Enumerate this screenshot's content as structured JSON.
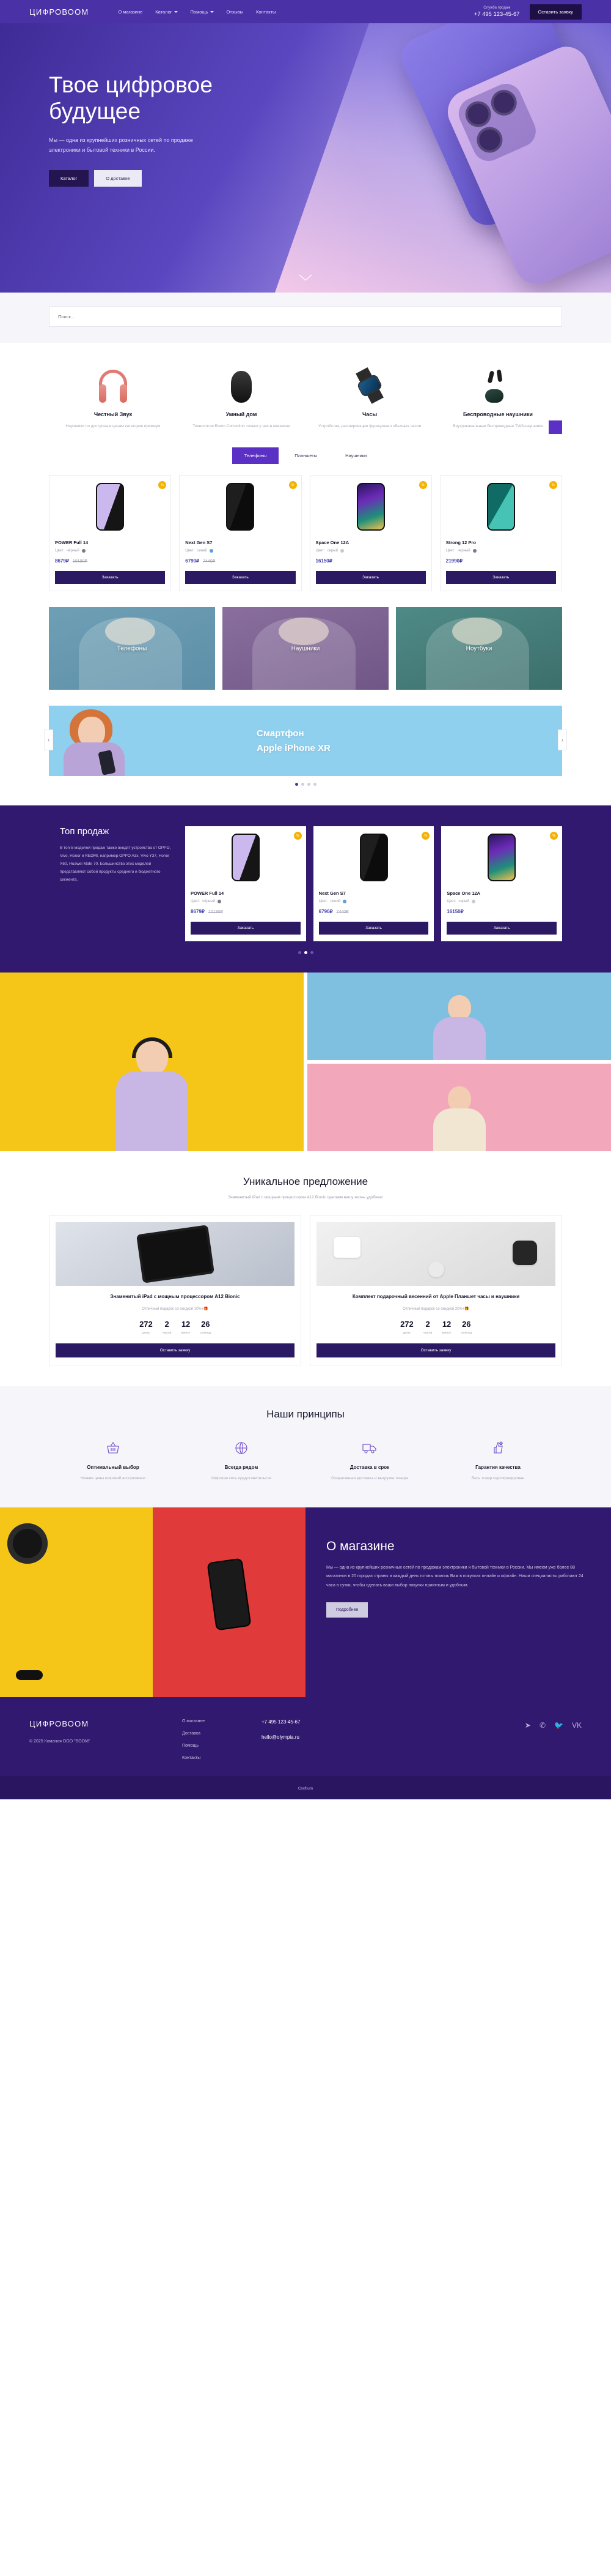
{
  "brand": {
    "name": "ЦИФРОВООМ",
    "accent": "#5b30c4",
    "dark": "#30196e"
  },
  "header": {
    "nav": [
      {
        "label": "О магазине",
        "caret": false
      },
      {
        "label": "Каталог",
        "caret": true
      },
      {
        "label": "Помощь",
        "caret": true
      },
      {
        "label": "Отзывы",
        "caret": false
      },
      {
        "label": "Контакты",
        "caret": false
      }
    ],
    "phone_label": "Служба продаж",
    "phone": "+7 495 123-45-67",
    "cta": "Оставить заявку"
  },
  "hero": {
    "title": "Твое цифровое будущее",
    "subtitle": "Мы — одна из крупнейших розничных сетей по продаже электроники и бытовой техники в России.",
    "btn_primary": "Каталог",
    "btn_secondary": "О доставке"
  },
  "search": {
    "placeholder": "Поиск...",
    "value": ""
  },
  "features": [
    {
      "icon": "headphones-icon",
      "title": "Честный Звук",
      "text": "Наушники по доступным ценам категория премиум"
    },
    {
      "icon": "smart-speaker-icon",
      "title": "Умный дом",
      "text": "Технология Room Correction только у нас в магазине"
    },
    {
      "icon": "smartwatch-icon",
      "title": "Часы",
      "text": "Устройства, расширяющие функционал обычных часов"
    },
    {
      "icon": "earbuds-icon",
      "title": "Беспроводные наушники",
      "text": "Внутриканальные беспроводные TWS-наушники"
    }
  ],
  "catalog": {
    "tabs": [
      {
        "label": "Телефоны",
        "active": true
      },
      {
        "label": "Планшеты",
        "active": false
      },
      {
        "label": "Наушники",
        "active": false
      }
    ],
    "order_label": "Заказать",
    "color_label": "Цвет:",
    "badge": "%",
    "products": [
      {
        "name": "POWER Full 14",
        "color": "чёрный",
        "dot": "#7b7b85",
        "price_new": "8679₽",
        "price_old": "10190₽",
        "screen": "screen-a"
      },
      {
        "name": "Next Gen S7",
        "color": "синий",
        "dot": "#5b9ee0",
        "price_new": "6790₽",
        "price_old": "7440₽",
        "screen": "screen-b"
      },
      {
        "name": "Space One 12A",
        "color": "серый",
        "dot": "#c9c9d2",
        "price_new": "16150₽",
        "price_old": "",
        "screen": "screen-c"
      },
      {
        "name": "Strong 12 Pro",
        "color": "черный",
        "dot": "#7b7b85",
        "price_new": "21990₽",
        "price_old": "",
        "screen": "screen-d"
      }
    ]
  },
  "categories": [
    {
      "label": "Телефоны"
    },
    {
      "label": "Наушники"
    },
    {
      "label": "Ноутбуки"
    }
  ],
  "slider": {
    "line1": "Смартфон",
    "line2": "Apple iPhone XR",
    "prev": "‹",
    "next": "›",
    "dots": 4,
    "active_dot": 0
  },
  "topsales": {
    "title": "Топ продаж",
    "text": "В топ-5 моделей продаж также входят устройства от OPPO, Vivo, Honor и REDMI, например OPPO A3x, Vivo Y37, Honor X60, Huawei Mate 70. Большинство этих моделей представляют собой продукты среднего и бюджетного сегмента.",
    "order_label": "Заказать",
    "color_label": "Цвет:",
    "products": [
      {
        "name": "POWER Full 14",
        "color": "чёрный",
        "dot": "#7b7b85",
        "price_new": "8679₽",
        "price_old": "10190₽",
        "screen": "screen-a"
      },
      {
        "name": "Next Gen S7",
        "color": "синий",
        "dot": "#5b9ee0",
        "price_new": "6790₽",
        "price_old": "7440₽",
        "screen": "screen-b"
      },
      {
        "name": "Space One 12A",
        "color": "серый",
        "dot": "#c9c9d2",
        "price_new": "16150₽",
        "price_old": "",
        "screen": "screen-c"
      }
    ],
    "dots": 3,
    "active_dot": 1
  },
  "unique": {
    "title": "Уникальное предложение",
    "subtitle": "Знаменитый iPad с мощным процессором A12 Bionic сделаем вашу жизнь удобнее!",
    "button": "Оставить заявку",
    "offers": [
      {
        "title": "Знаменитый iPad с мощным процессором A12 Bionic",
        "desc": "Отличный подарок со скидкой 10%+🎁",
        "timer": [
          {
            "value": "272",
            "unit": "день"
          },
          {
            "value": "2",
            "unit": "часов"
          },
          {
            "value": "12",
            "unit": "минут"
          },
          {
            "value": "26",
            "unit": "секунд"
          }
        ]
      },
      {
        "title": "Комплект подарочный весенний от Apple Планшет часы и наушники",
        "desc": "Отличный подарок со скидкой 20%+🎁",
        "timer": [
          {
            "value": "272",
            "unit": "день"
          },
          {
            "value": "2",
            "unit": "часов"
          },
          {
            "value": "12",
            "unit": "минут"
          },
          {
            "value": "26",
            "unit": "секунд"
          }
        ]
      }
    ]
  },
  "principles": {
    "title": "Наши принципы",
    "items": [
      {
        "icon": "basket-icon",
        "title": "Оптимальный выбор",
        "text": "Низкие цены широкий ассортимент"
      },
      {
        "icon": "globe-icon",
        "title": "Всегда рядом",
        "text": "Широкая сеть представительств"
      },
      {
        "icon": "truck-icon",
        "title": "Доставка в срок",
        "text": "Оперативная доставка и выгрузка товара"
      },
      {
        "icon": "thumbs-up-icon",
        "title": "Гарантия качества",
        "text": "Весь товар сертифицирован"
      }
    ]
  },
  "about": {
    "title": "О магазине",
    "text": "Мы — одна из крупнейших розничных сетей по продажам электроники и бытовой техники в России. Мы имеем уже более 88 магазинов в 20 городах страны и каждый день готовы помочь Вам в покупках онлайн и офлайн. Наши специалисты работают 24 часа в сутки, чтобы сделать ваши выбор покупки приятным и удобным.",
    "button": "Подробнее"
  },
  "footer": {
    "logo": "ЦИФРОВООМ",
    "copyright": "© 2025 Комания ООО \"BOOM\"",
    "nav": [
      {
        "label": "О магазине"
      },
      {
        "label": "Доставка"
      },
      {
        "label": "Помощь"
      },
      {
        "label": "Контакты"
      }
    ],
    "phone": "+7 495 123-45-67",
    "email": "hello@olympia.ru",
    "socials": [
      {
        "icon": "telegram-icon",
        "glyph": "➤"
      },
      {
        "icon": "whatsapp-icon",
        "glyph": "✆"
      },
      {
        "icon": "twitter-icon",
        "glyph": "🐦"
      },
      {
        "icon": "vk-icon",
        "glyph": "VK"
      }
    ],
    "made_by": "Craftium"
  }
}
